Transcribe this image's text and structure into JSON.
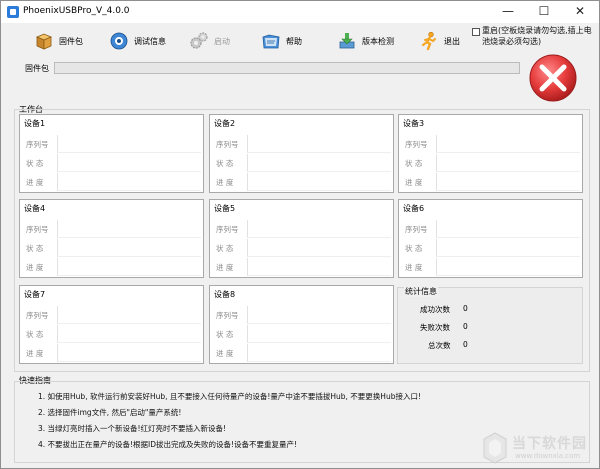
{
  "window": {
    "title": "PhoenixUSBPro_V_4.0.0"
  },
  "titlebar_buttons": {
    "minimize": "—",
    "maximize": "☐",
    "close": "✕"
  },
  "toolbar": {
    "items": [
      {
        "label": "固件包",
        "icon": "firmware-box-icon",
        "enabled": true
      },
      {
        "label": "调试信息",
        "icon": "debug-info-icon",
        "enabled": true
      },
      {
        "label": "启动",
        "icon": "gears-icon",
        "enabled": false
      },
      {
        "label": "帮助",
        "icon": "help-folder-icon",
        "enabled": true
      },
      {
        "label": "版本检测",
        "icon": "version-check-icon",
        "enabled": true
      },
      {
        "label": "退出",
        "icon": "exit-runner-icon",
        "enabled": true
      }
    ],
    "restart_option": "重启(空板烧录请勿勾选,插上电池烧录必须勾选)",
    "restart_checked": false
  },
  "firmware": {
    "label": "固件包",
    "value": ""
  },
  "status_indicator": {
    "icon": "red-x-icon",
    "color": "#e53b3b"
  },
  "workbench": {
    "label": "工作台",
    "row_labels": {
      "serial": "序列号",
      "status": "状 态",
      "progress": "进 度"
    },
    "devices": [
      {
        "name": "设备1",
        "serial": "",
        "status": "",
        "progress": ""
      },
      {
        "name": "设备2",
        "serial": "",
        "status": "",
        "progress": ""
      },
      {
        "name": "设备3",
        "serial": "",
        "status": "",
        "progress": ""
      },
      {
        "name": "设备4",
        "serial": "",
        "status": "",
        "progress": ""
      },
      {
        "name": "设备5",
        "serial": "",
        "status": "",
        "progress": ""
      },
      {
        "name": "设备6",
        "serial": "",
        "status": "",
        "progress": ""
      },
      {
        "name": "设备7",
        "serial": "",
        "status": "",
        "progress": ""
      },
      {
        "name": "设备8",
        "serial": "",
        "status": "",
        "progress": ""
      }
    ]
  },
  "stats": {
    "title": "统计信息",
    "rows": [
      {
        "label": "成功次数",
        "value": "0"
      },
      {
        "label": "失败次数",
        "value": "0"
      },
      {
        "label": "总次数",
        "value": "0"
      }
    ]
  },
  "guide": {
    "label": "快速指南",
    "lines": [
      "1. 如使用Hub, 软件运行前安装好Hub, 且不要接入任何待量产的设备!量产中途不要插拔Hub, 不要更换Hub接入口!",
      "2. 选择固件img文件, 然后\"启动\"量产系统!",
      "3. 当绿灯亮时插入一个新设备!红灯亮时不要插入新设备!",
      "4. 不要拔出正在量产的设备!根据ID拔出完成及失败的设备!设备不要重复量产!"
    ]
  },
  "watermark": {
    "name": "当下软件园",
    "url": "www.downxia.com"
  },
  "colors": {
    "window_bg": "#f0f0f0",
    "panel_bg": "#ffffff",
    "error_red": "#e53b3b",
    "disabled_text": "#999999"
  }
}
